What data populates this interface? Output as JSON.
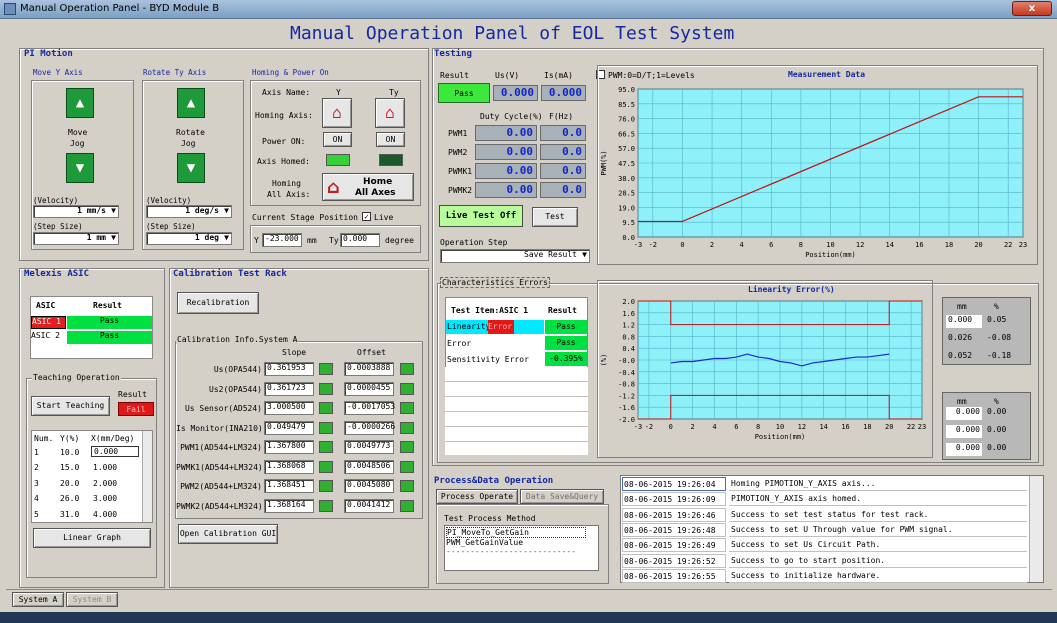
{
  "window": {
    "title": "Manual Operation Panel - BYD Module B",
    "close": "x"
  },
  "main_title": "Manual Operation Panel of EOL Test System",
  "pi_motion": {
    "title": "PI Motion",
    "move_y": {
      "title": "Move Y Axis",
      "label1": "Move",
      "label2": "Jog",
      "velocity_label": "(Velocity)",
      "velocity": "1 mm/s",
      "step_label": "(Step Size)",
      "step": "1 mm"
    },
    "rotate_ty": {
      "title": "Rotate Ty Axis",
      "label1": "Rotate",
      "label2": "Jog",
      "velocity_label": "(Velocity)",
      "velocity": "1 deg/s",
      "step_label": "(Step Size)",
      "step": "1 deg"
    },
    "homing": {
      "title": "Homing & Power On",
      "axis_name": "Axis Name:",
      "col_y": "Y",
      "col_ty": "Ty",
      "homing_axis": "Homing Axis:",
      "power_on": "Power ON:",
      "on_y": "ON",
      "on_ty": "ON",
      "axis_homed": "Axis Homed:",
      "homing_all1": "Homing",
      "homing_all2": "All Axis:",
      "home_btn1": "Home",
      "home_btn2": "All Axes"
    },
    "position": {
      "title": "Current Stage Position",
      "live": "Live",
      "y_label": "Y",
      "y_value": "-23.000",
      "y_unit": "mm",
      "ty_label": "Ty",
      "ty_value": "0.000",
      "ty_unit": "degree"
    }
  },
  "testing": {
    "title": "Testing",
    "result_label": "Result",
    "us_label": "Us(V)",
    "is_label": "Is(mA)",
    "result": "Pass",
    "us_value": "0.000",
    "is_value": "0.000",
    "pwm_checkbox": "PWM:0=D/T;1=Levels",
    "duty_label": "Duty Cycle(%)",
    "freq_label": "F(Hz)",
    "pwm_rows": [
      {
        "name": "PWM1",
        "duty": "0.00",
        "freq": "0.0"
      },
      {
        "name": "PWM2",
        "duty": "0.00",
        "freq": "0.0"
      },
      {
        "name": "PWMK1",
        "duty": "0.00",
        "freq": "0.0"
      },
      {
        "name": "PWMK2",
        "duty": "0.00",
        "freq": "0.0"
      }
    ],
    "live_btn": "Live Test Off",
    "test_btn": "Test",
    "op_step_label": "Operation Step",
    "op_step": "Save Result",
    "char_errors": "Characteristics Errors"
  },
  "char_table": {
    "headers": [
      "Test Item:ASIC 1",
      "Result"
    ],
    "rows": [
      {
        "item": "Linearity",
        "tag": "Error",
        "result": "Pass"
      },
      {
        "item": "Error",
        "tag": "",
        "result": "Pass"
      },
      {
        "item": "Sensitivity Error",
        "tag": "",
        "result": "-0.395%"
      }
    ]
  },
  "mini_tables": {
    "top": {
      "h1": "mm",
      "h2": "%",
      "rows": [
        [
          "0.000",
          "0.05"
        ],
        [
          "0.026",
          "-0.08"
        ],
        [
          "0.052",
          "-0.18"
        ]
      ]
    },
    "bottom": {
      "h1": "mm",
      "h2": "%",
      "rows": [
        [
          "0.000",
          "0.00"
        ],
        [
          "0.000",
          "0.00"
        ],
        [
          "0.000",
          "0.00"
        ]
      ]
    }
  },
  "melexis": {
    "title": "Melexis ASIC",
    "headers": [
      "ASIC",
      "Result"
    ],
    "rows": [
      {
        "asic": "ASIC 1",
        "result": "Pass"
      },
      {
        "asic": "ASIC 2",
        "result": "Pass"
      }
    ],
    "teaching_title": "Teaching Operation",
    "start_btn": "Start Teaching",
    "result_label": "Result",
    "result_val": "Fail",
    "table_headers": [
      "Num.",
      "Y(%)",
      "X(mm/Deg)"
    ],
    "table_rows": [
      [
        "1",
        "10.0",
        "0.000"
      ],
      [
        "2",
        "15.0",
        "1.000"
      ],
      [
        "3",
        "20.0",
        "2.000"
      ],
      [
        "4",
        "26.0",
        "3.000"
      ],
      [
        "5",
        "31.0",
        "4.000"
      ]
    ],
    "linear_btn": "Linear Graph"
  },
  "calibration": {
    "title": "Calibration Test Rack",
    "recal_btn": "Recalibration",
    "info_title": "Calibration Info.System A",
    "slope_label": "Slope",
    "offset_label": "Offset",
    "rows": [
      {
        "name": "Us(OPA544)",
        "slope": "0.361953",
        "offset": "0.0003888"
      },
      {
        "name": "Us2(OPA544)",
        "slope": "0.361723",
        "offset": "0.0000455"
      },
      {
        "name": "Us Sensor(AD524)",
        "slope": "3.000500",
        "offset": "-0.0017053"
      },
      {
        "name": "Is Monitor(INA210)",
        "slope": "0.049479",
        "offset": "-0.0000266"
      },
      {
        "name": "PWM1(AD544+LM324)",
        "slope": "1.367800",
        "offset": "0.0049773"
      },
      {
        "name": "PWMK1(AD544+LM324)",
        "slope": "1.368068",
        "offset": "0.0048506"
      },
      {
        "name": "PWM2(AD544+LM324)",
        "slope": "1.368451",
        "offset": "0.0045080"
      },
      {
        "name": "PWMK2(AD544+LM324)",
        "slope": "1.368164",
        "offset": "0.0041412"
      }
    ],
    "open_gui_btn": "Open Calibration GUI"
  },
  "process": {
    "title": "Process&Data Operation",
    "tab1": "Process Operate",
    "tab2": "Data Save&Query",
    "method_label": "Test Process Method",
    "methods": [
      "PI_MoveTo_GetGain",
      "PWM_GetGainValue",
      "---------------------------"
    ]
  },
  "log": [
    {
      "time": "08-06-2015 19:26:04",
      "msg": "Homing PIMOTION_Y_AXIS axis..."
    },
    {
      "time": "08-06-2015 19:26:09",
      "msg": "PIMOTION_Y_AXIS axis homed."
    },
    {
      "time": "08-06-2015 19:26:46",
      "msg": "Success to set test status for test rack."
    },
    {
      "time": "08-06-2015 19:26:48",
      "msg": "Success to set U Through value for PWM signal."
    },
    {
      "time": "08-06-2015 19:26:49",
      "msg": "Success to set Us Circuit Path."
    },
    {
      "time": "08-06-2015 19:26:52",
      "msg": "Success to go to start position."
    },
    {
      "time": "08-06-2015 19:26:55",
      "msg": "Success to initialize hardware."
    }
  ],
  "bottom_tabs": [
    "System A",
    "System B"
  ],
  "chart_data": [
    {
      "type": "line",
      "title": "Measurement Data",
      "xlabel": "Position(mm)",
      "ylabel": "PWM(%)",
      "xlim": [
        -3,
        23
      ],
      "ylim": [
        0,
        95
      ],
      "x_ticks": [
        "-3",
        "-2",
        "0",
        "2",
        "4",
        "6",
        "8",
        "10",
        "12",
        "14",
        "16",
        "18",
        "20",
        "22",
        "23"
      ],
      "y_ticks": [
        "95.0",
        "85.5",
        "76.0",
        "66.5",
        "57.0",
        "47.5",
        "38.0",
        "28.5",
        "19.0",
        "9.5",
        "0.0"
      ],
      "series": [
        {
          "x": [
            -3,
            0,
            20,
            23
          ],
          "y": [
            10,
            10,
            90,
            90
          ]
        }
      ]
    },
    {
      "type": "line",
      "title": "Linearity Error(%)",
      "xlabel": "Position(mm)",
      "ylabel": "(%)",
      "xlim": [
        -3,
        23
      ],
      "ylim": [
        -2,
        2
      ],
      "x_ticks": [
        "-3",
        "-2",
        "0",
        "2",
        "4",
        "6",
        "8",
        "10",
        "12",
        "14",
        "16",
        "18",
        "20",
        "22",
        "23"
      ],
      "y_ticks": [
        "2.0",
        "1.6",
        "1.2",
        "0.8",
        "0.4",
        "-0.0",
        "-0.4",
        "-0.8",
        "-1.2",
        "-1.6",
        "-2.0"
      ],
      "series": [
        {
          "x": [
            0,
            1,
            2,
            3,
            4,
            5,
            6,
            7,
            8,
            9,
            10,
            11,
            12,
            13,
            14,
            15,
            16,
            17,
            18,
            19,
            20
          ],
          "y": [
            -0.1,
            -0.05,
            -0.05,
            0.0,
            0.05,
            0.05,
            0.1,
            0.2,
            0.1,
            0.05,
            -0.05,
            -0.1,
            -0.2,
            -0.1,
            -0.05,
            0.0,
            0.05,
            0.1,
            0.1,
            0.15,
            0.2
          ]
        },
        {
          "x": [
            -3,
            0,
            0,
            20,
            20,
            23
          ],
          "y": [
            2,
            2,
            1.2,
            1.2,
            2,
            2
          ]
        },
        {
          "x": [
            -3,
            0,
            0,
            20,
            20,
            23
          ],
          "y": [
            -2,
            -2,
            -1.2,
            -1.2,
            -2,
            -2
          ]
        }
      ]
    }
  ]
}
